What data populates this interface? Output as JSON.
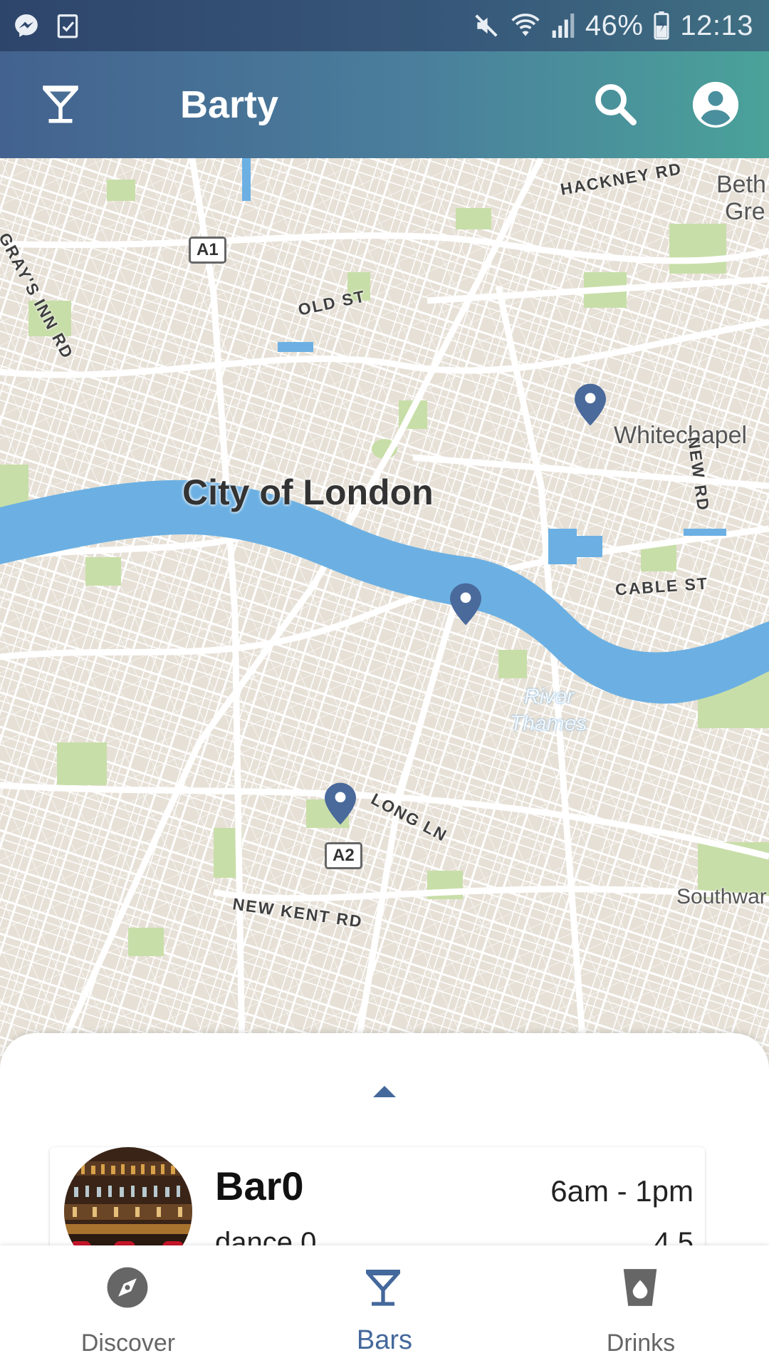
{
  "status_bar": {
    "battery": "46%",
    "time": "12:13",
    "icons": [
      "messenger-icon",
      "task-check-icon",
      "mute-icon",
      "wifi-icon",
      "signal-icon",
      "battery-charging-icon"
    ]
  },
  "app_bar": {
    "title": "Barty",
    "logo_icon": "cocktail-glass-icon",
    "search_icon": "search-icon",
    "account_icon": "account-circle-icon"
  },
  "map": {
    "place_labels": {
      "city": "City of London",
      "whitechapel": "Whitechapel",
      "bethnal": "Beth",
      "bethnal2": "Gre",
      "southwark": "Southwar"
    },
    "road_labels": {
      "hackney": "HACKNEY RD",
      "old_st": "OLD ST",
      "grays_inn": "GRAY'S INN RD",
      "new_rd": "NEW RD",
      "cable_st": "CABLE ST",
      "long_ln": "LONG LN",
      "new_kent": "NEW KENT RD"
    },
    "shields": {
      "a1": "A1",
      "a2": "A2"
    },
    "river_label": [
      "River",
      "Thames"
    ],
    "colors": {
      "water": "#6cb0e3",
      "park": "#c8dea8",
      "pin": "#4a6a9c"
    }
  },
  "bars_list": [
    {
      "name": "Bar0",
      "hours": "6am - 1pm",
      "description": "dance 0",
      "rating": "4.5"
    }
  ],
  "bottom_nav": {
    "items": [
      {
        "label": "Discover",
        "icon": "compass-icon",
        "active": false
      },
      {
        "label": "Bars",
        "icon": "cocktail-glass-icon",
        "active": true
      },
      {
        "label": "Drinks",
        "icon": "cup-icon",
        "active": false
      }
    ],
    "active_color": "#44689c"
  }
}
